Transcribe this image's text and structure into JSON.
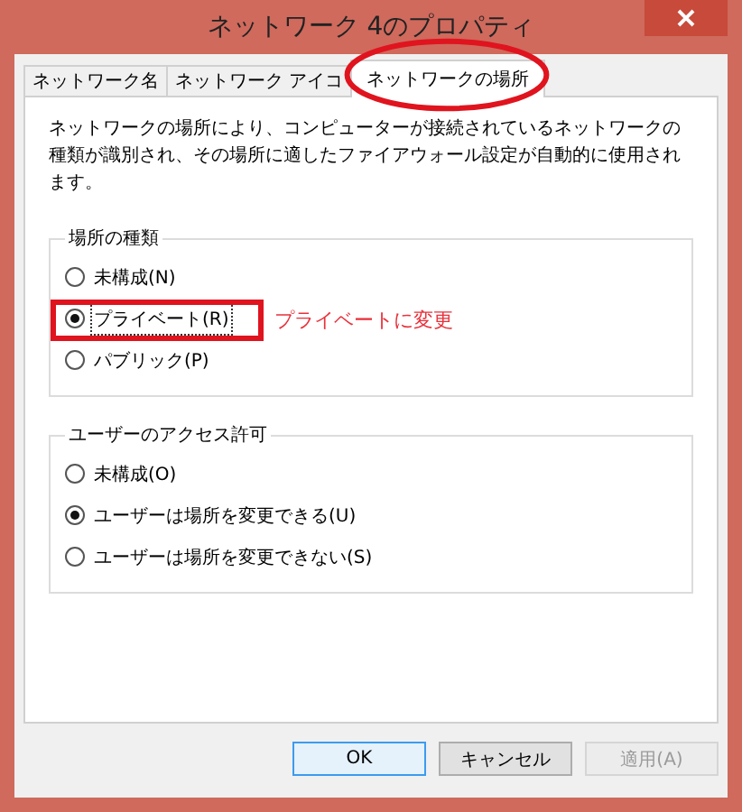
{
  "window": {
    "title": "ネットワーク  4のプロパティ"
  },
  "tabs": [
    {
      "label": "ネットワーク名",
      "selected": false
    },
    {
      "label": "ネットワーク アイコ",
      "selected": false
    },
    {
      "label": "ネットワークの場所",
      "selected": true
    }
  ],
  "description": "ネットワークの場所により、コンピューターが接続されているネットワークの種類が識別され、その場所に適したファイアウォール設定が自動的に使用されます。",
  "groups": [
    {
      "title": "場所の種類",
      "options": [
        {
          "label": "未構成(N)",
          "selected": false,
          "focused": false
        },
        {
          "label": "プライベート(R)",
          "selected": true,
          "focused": true
        },
        {
          "label": "パブリック(P)",
          "selected": false,
          "focused": false
        }
      ]
    },
    {
      "title": "ユーザーのアクセス許可",
      "options": [
        {
          "label": "未構成(O)",
          "selected": false,
          "focused": false
        },
        {
          "label": "ユーザーは場所を変更できる(U)",
          "selected": true,
          "focused": false
        },
        {
          "label": "ユーザーは場所を変更できない(S)",
          "selected": false,
          "focused": false
        }
      ]
    }
  ],
  "buttons": [
    {
      "label": "OK",
      "default": true,
      "disabled": false
    },
    {
      "label": "キャンセル",
      "default": false,
      "disabled": false
    },
    {
      "label": "適用(A)",
      "default": false,
      "disabled": true
    }
  ],
  "annotation": {
    "note": "プライベートに変更"
  }
}
